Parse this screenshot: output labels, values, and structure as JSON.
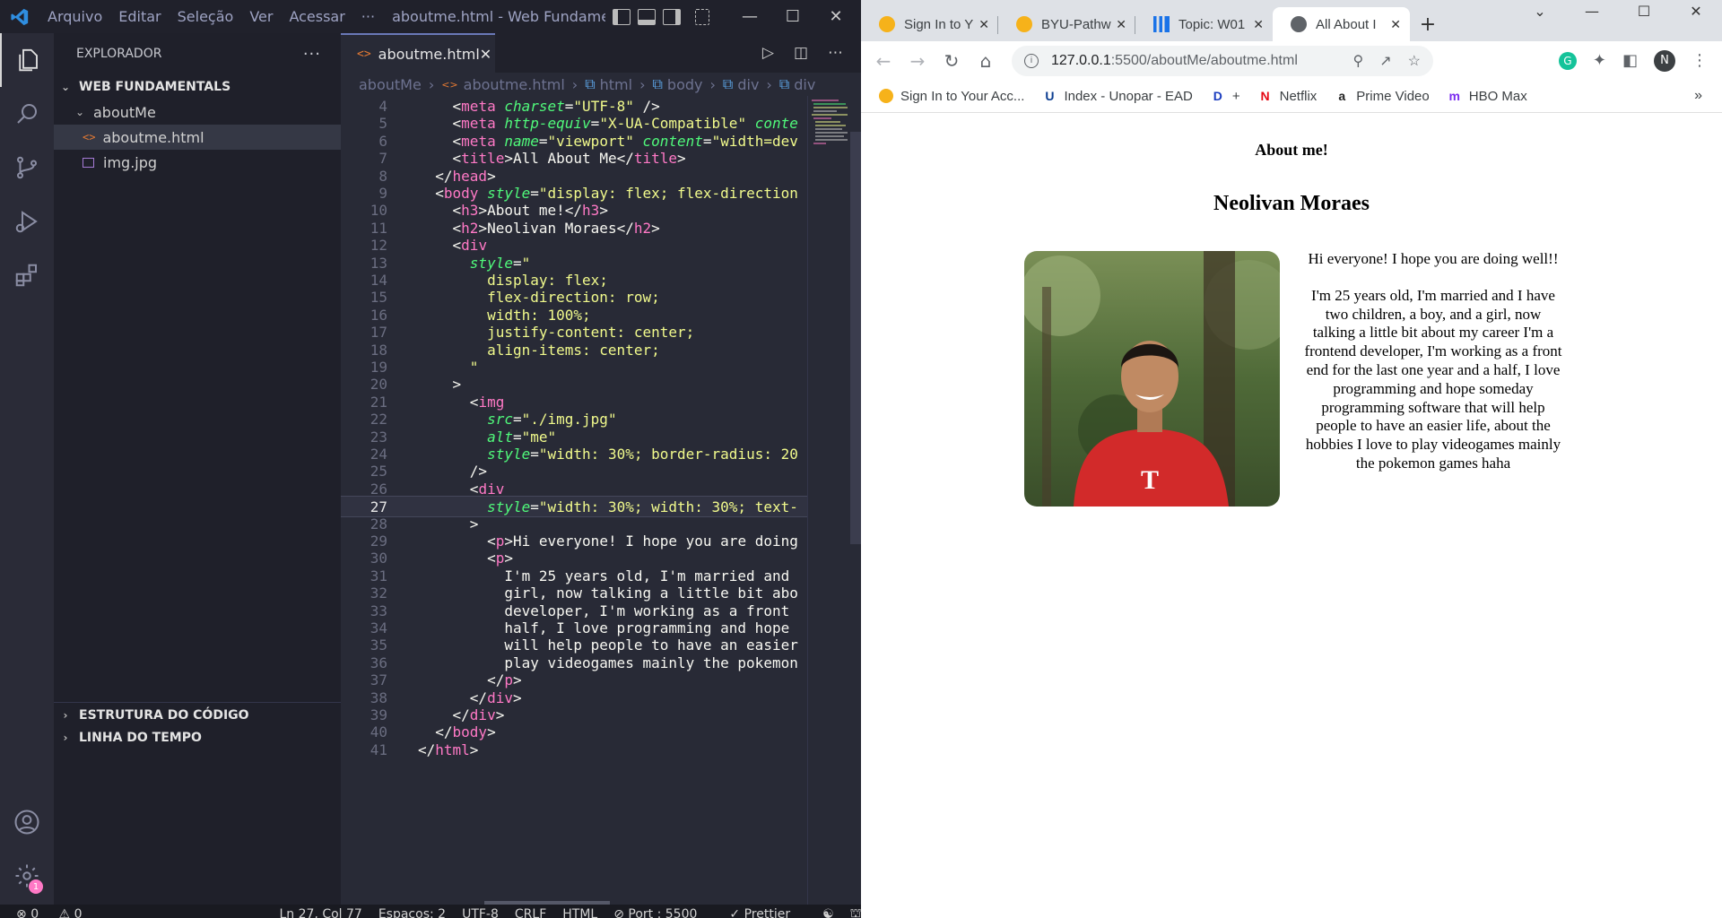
{
  "vscode": {
    "menu": [
      "Arquivo",
      "Editar",
      "Seleção",
      "Ver",
      "Acessar",
      "···"
    ],
    "window_title": "aboutme.html - Web Fundamenta...",
    "explorer": {
      "header": "EXPLORADOR",
      "more": "···",
      "workspace": "WEB FUNDAMENTALS",
      "folder": "aboutMe",
      "files": [
        "aboutme.html",
        "img.jpg"
      ],
      "outline": "ESTRUTURA DO CÓDIGO",
      "timeline": "LINHA DO TEMPO"
    },
    "tab": {
      "icon": "<>",
      "label": "aboutme.html"
    },
    "breadcrumb": [
      "aboutMe",
      "aboutme.html",
      "html",
      "body",
      "div",
      "div"
    ],
    "code_lines": [
      {
        "n": "4",
        "tokens": [
          [
            "pl",
            "    "
          ],
          [
            "br",
            "<"
          ],
          [
            "tg",
            "meta"
          ],
          [
            "pl",
            " "
          ],
          [
            "at",
            "charset"
          ],
          [
            "pl",
            "="
          ],
          [
            "st",
            "\"UTF-8\""
          ],
          [
            "pl",
            " />"
          ]
        ]
      },
      {
        "n": "5",
        "tokens": [
          [
            "pl",
            "    "
          ],
          [
            "br",
            "<"
          ],
          [
            "tg",
            "meta"
          ],
          [
            "pl",
            " "
          ],
          [
            "at",
            "http-equiv"
          ],
          [
            "pl",
            "="
          ],
          [
            "st",
            "\"X-UA-Compatible\""
          ],
          [
            "pl",
            " "
          ],
          [
            "at",
            "conte"
          ]
        ]
      },
      {
        "n": "6",
        "tokens": [
          [
            "pl",
            "    "
          ],
          [
            "br",
            "<"
          ],
          [
            "tg",
            "meta"
          ],
          [
            "pl",
            " "
          ],
          [
            "at",
            "name"
          ],
          [
            "pl",
            "="
          ],
          [
            "st",
            "\"viewport\""
          ],
          [
            "pl",
            " "
          ],
          [
            "at",
            "content"
          ],
          [
            "pl",
            "="
          ],
          [
            "st",
            "\"width=dev"
          ]
        ]
      },
      {
        "n": "7",
        "tokens": [
          [
            "pl",
            "    "
          ],
          [
            "br",
            "<"
          ],
          [
            "tg",
            "title"
          ],
          [
            "br",
            ">"
          ],
          [
            "pl",
            "All About Me"
          ],
          [
            "br",
            "</"
          ],
          [
            "tg",
            "title"
          ],
          [
            "br",
            ">"
          ]
        ]
      },
      {
        "n": "8",
        "tokens": [
          [
            "pl",
            "  "
          ],
          [
            "br",
            "</"
          ],
          [
            "tg",
            "head"
          ],
          [
            "br",
            ">"
          ]
        ]
      },
      {
        "n": "9",
        "tokens": [
          [
            "pl",
            "  "
          ],
          [
            "br",
            "<"
          ],
          [
            "tg",
            "body"
          ],
          [
            "pl",
            " "
          ],
          [
            "at",
            "style"
          ],
          [
            "pl",
            "="
          ],
          [
            "st",
            "\"display: flex; flex-direction"
          ]
        ]
      },
      {
        "n": "10",
        "tokens": [
          [
            "pl",
            "    "
          ],
          [
            "br",
            "<"
          ],
          [
            "tg",
            "h3"
          ],
          [
            "br",
            ">"
          ],
          [
            "pl",
            "About me!"
          ],
          [
            "br",
            "</"
          ],
          [
            "tg",
            "h3"
          ],
          [
            "br",
            ">"
          ]
        ]
      },
      {
        "n": "11",
        "tokens": [
          [
            "pl",
            "    "
          ],
          [
            "br",
            "<"
          ],
          [
            "tg",
            "h2"
          ],
          [
            "br",
            ">"
          ],
          [
            "pl",
            "Neolivan Moraes"
          ],
          [
            "br",
            "</"
          ],
          [
            "tg",
            "h2"
          ],
          [
            "br",
            ">"
          ]
        ]
      },
      {
        "n": "12",
        "tokens": [
          [
            "pl",
            "    "
          ],
          [
            "br",
            "<"
          ],
          [
            "tg",
            "div"
          ]
        ]
      },
      {
        "n": "13",
        "tokens": [
          [
            "pl",
            "      "
          ],
          [
            "at",
            "style"
          ],
          [
            "pl",
            "="
          ],
          [
            "st",
            "\""
          ]
        ]
      },
      {
        "n": "14",
        "tokens": [
          [
            "st",
            "        display: flex;"
          ]
        ]
      },
      {
        "n": "15",
        "tokens": [
          [
            "st",
            "        flex-direction: row;"
          ]
        ]
      },
      {
        "n": "16",
        "tokens": [
          [
            "st",
            "        width: 100%;"
          ]
        ]
      },
      {
        "n": "17",
        "tokens": [
          [
            "st",
            "        justify-content: center;"
          ]
        ]
      },
      {
        "n": "18",
        "tokens": [
          [
            "st",
            "        align-items: center;"
          ]
        ]
      },
      {
        "n": "19",
        "tokens": [
          [
            "st",
            "      \""
          ]
        ]
      },
      {
        "n": "20",
        "tokens": [
          [
            "pl",
            "    "
          ],
          [
            "br",
            ">"
          ]
        ]
      },
      {
        "n": "21",
        "tokens": [
          [
            "pl",
            "      "
          ],
          [
            "br",
            "<"
          ],
          [
            "tg",
            "img"
          ]
        ]
      },
      {
        "n": "22",
        "tokens": [
          [
            "pl",
            "        "
          ],
          [
            "at",
            "src"
          ],
          [
            "pl",
            "="
          ],
          [
            "st",
            "\"./img.jpg\""
          ]
        ]
      },
      {
        "n": "23",
        "tokens": [
          [
            "pl",
            "        "
          ],
          [
            "at",
            "alt"
          ],
          [
            "pl",
            "="
          ],
          [
            "st",
            "\"me\""
          ]
        ]
      },
      {
        "n": "24",
        "tokens": [
          [
            "pl",
            "        "
          ],
          [
            "at",
            "style"
          ],
          [
            "pl",
            "="
          ],
          [
            "st",
            "\"width: 30%; border-radius: 20"
          ]
        ]
      },
      {
        "n": "25",
        "tokens": [
          [
            "pl",
            "      "
          ],
          [
            "br",
            "/>"
          ]
        ]
      },
      {
        "n": "26",
        "tokens": [
          [
            "pl",
            "      "
          ],
          [
            "br",
            "<"
          ],
          [
            "tg",
            "div"
          ]
        ]
      },
      {
        "n": "27",
        "tokens": [
          [
            "pl",
            "        "
          ],
          [
            "at",
            "style"
          ],
          [
            "pl",
            "="
          ],
          [
            "st",
            "\"width: 30%; width: 30%; text-"
          ]
        ]
      },
      {
        "n": "28",
        "tokens": [
          [
            "pl",
            "      "
          ],
          [
            "br",
            ">"
          ]
        ]
      },
      {
        "n": "29",
        "tokens": [
          [
            "pl",
            "        "
          ],
          [
            "br",
            "<"
          ],
          [
            "tg",
            "p"
          ],
          [
            "br",
            ">"
          ],
          [
            "pl",
            "Hi everyone! I hope you are doing"
          ]
        ]
      },
      {
        "n": "30",
        "tokens": [
          [
            "pl",
            "        "
          ],
          [
            "br",
            "<"
          ],
          [
            "tg",
            "p"
          ],
          [
            "br",
            ">"
          ]
        ]
      },
      {
        "n": "31",
        "tokens": [
          [
            "pl",
            "          I'm 25 years old, I'm married and"
          ]
        ]
      },
      {
        "n": "32",
        "tokens": [
          [
            "pl",
            "          girl, now talking a little bit abo"
          ]
        ]
      },
      {
        "n": "33",
        "tokens": [
          [
            "pl",
            "          developer, I'm working as a front"
          ]
        ]
      },
      {
        "n": "34",
        "tokens": [
          [
            "pl",
            "          half, I love programming and hope"
          ]
        ]
      },
      {
        "n": "35",
        "tokens": [
          [
            "pl",
            "          will help people to have an easier"
          ]
        ]
      },
      {
        "n": "36",
        "tokens": [
          [
            "pl",
            "          play videogames mainly the pokemon"
          ]
        ]
      },
      {
        "n": "37",
        "tokens": [
          [
            "pl",
            "        "
          ],
          [
            "br",
            "</"
          ],
          [
            "tg",
            "p"
          ],
          [
            "br",
            ">"
          ]
        ]
      },
      {
        "n": "38",
        "tokens": [
          [
            "pl",
            "      "
          ],
          [
            "br",
            "</"
          ],
          [
            "tg",
            "div"
          ],
          [
            "br",
            ">"
          ]
        ]
      },
      {
        "n": "39",
        "tokens": [
          [
            "pl",
            "    "
          ],
          [
            "br",
            "</"
          ],
          [
            "tg",
            "div"
          ],
          [
            "br",
            ">"
          ]
        ]
      },
      {
        "n": "40",
        "tokens": [
          [
            "pl",
            "  "
          ],
          [
            "br",
            "</"
          ],
          [
            "tg",
            "body"
          ],
          [
            "br",
            ">"
          ]
        ]
      },
      {
        "n": "41",
        "tokens": [
          [
            "br",
            "</"
          ],
          [
            "tg",
            "html"
          ],
          [
            "br",
            ">"
          ]
        ]
      }
    ],
    "current_line": "27",
    "status": {
      "problems_errors": "0",
      "problems_warnings": "0",
      "position": "Ln 27, Col 77",
      "spaces": "Espaços: 2",
      "encoding": "UTF-8",
      "eol": "CRLF",
      "language": "HTML",
      "port": "Port : 5500",
      "formatter": "Prettier",
      "settings_badge": "1"
    }
  },
  "browser": {
    "tabs": [
      {
        "label": "Sign In to Y",
        "color": "#f6b21a"
      },
      {
        "label": "BYU-Pathw",
        "color": "#f6b21a"
      },
      {
        "label": "Topic: W01",
        "color": "#1a73e8"
      },
      {
        "label": "All About I",
        "color": "#5f6368",
        "active": true
      }
    ],
    "new_tab": "+",
    "url_host": "127.0.0.1",
    "url_path": ":5500/aboutMe/aboutme.html",
    "profile_initial": "N",
    "bookmarks": [
      {
        "label": "Sign In to Your Acc...",
        "icon": "S",
        "color": "#f6b21a"
      },
      {
        "label": "Index - Unopar - EAD",
        "icon": "U",
        "color": "#0b3d91"
      },
      {
        "label": "+",
        "icon": "D",
        "color": "#1a3cbf"
      },
      {
        "label": "Netflix",
        "icon": "N",
        "color": "#e50914"
      },
      {
        "label": "Prime Video",
        "icon": "a",
        "color": "#222"
      },
      {
        "label": "HBO Max",
        "icon": "m",
        "color": "#7b2cf0"
      }
    ],
    "bookmarks_more": "»",
    "page": {
      "h3": "About me!",
      "h2": "Neolivan Moraes",
      "img_alt": "me",
      "p1": "Hi everyone! I hope you are doing well!!",
      "p2": "I'm 25 years old, I'm married and I have two children, a boy, and a girl, now talking a little bit about my career I'm a frontend developer, I'm working as a front end for the last one year and a half, I love programming and hope someday programming software that will help people to have an easier life, about the hobbies I love to play videogames mainly the pokemon games haha"
    }
  }
}
